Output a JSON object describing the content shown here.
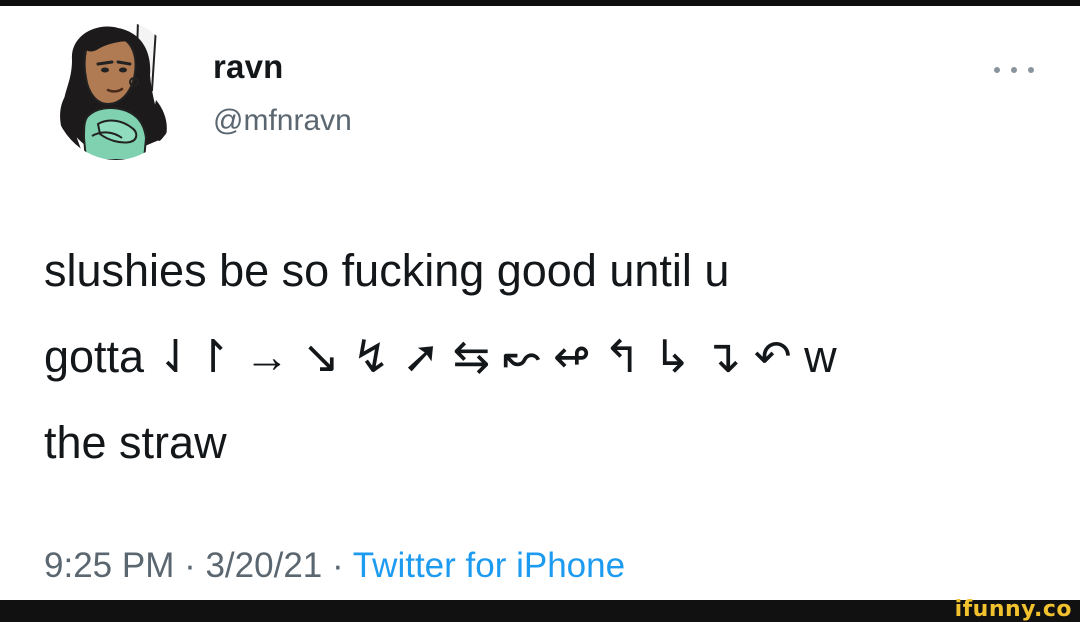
{
  "tweet": {
    "author": {
      "display_name": "ravn",
      "handle": "@mfnravn",
      "avatar_icon": "cartoon-avatar"
    },
    "more_icon": "more-options-icon",
    "text_lines": [
      "slushies be so fucking good until u",
      "gotta ⇃↾ → ↘ ↯ ➚ ⇆ ↜ ↫ ↰ ↳ ↴ ↶ w",
      "the straw"
    ],
    "meta": {
      "time": "9:25 PM",
      "separator": " · ",
      "date": "3/20/21",
      "source": "Twitter for iPhone"
    }
  },
  "watermark": "ifunny.co",
  "colors": {
    "text_primary": "#14171a",
    "text_secondary": "#5b6770",
    "link": "#1d9bf0",
    "watermark": "#f2c12e"
  }
}
